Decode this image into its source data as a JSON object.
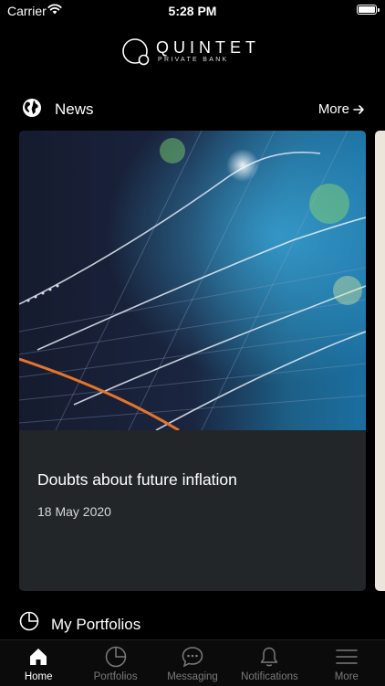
{
  "status_bar": {
    "carrier": "Carrier",
    "time": "5:28 PM"
  },
  "brand": {
    "name": "QUINTET",
    "tagline": "PRIVATE BANK"
  },
  "news": {
    "title": "News",
    "more_label": "More",
    "articles": [
      {
        "headline": "Doubts about future inflation",
        "date": "18 May 2020"
      }
    ]
  },
  "portfolios": {
    "title": "My Portfolios"
  },
  "tab_bar": {
    "active": "Home",
    "tabs": [
      {
        "label": "Home",
        "icon": "home-icon"
      },
      {
        "label": "Portfolios",
        "icon": "pie-chart-icon"
      },
      {
        "label": "Messaging",
        "icon": "chat-bubble-icon"
      },
      {
        "label": "Notifications",
        "icon": "bell-icon"
      },
      {
        "label": "More",
        "icon": "menu-icon"
      }
    ]
  },
  "colors": {
    "background": "#000000",
    "card": "#222629",
    "tab_inactive": "#7b7b7b",
    "tab_active": "#ffffff"
  }
}
